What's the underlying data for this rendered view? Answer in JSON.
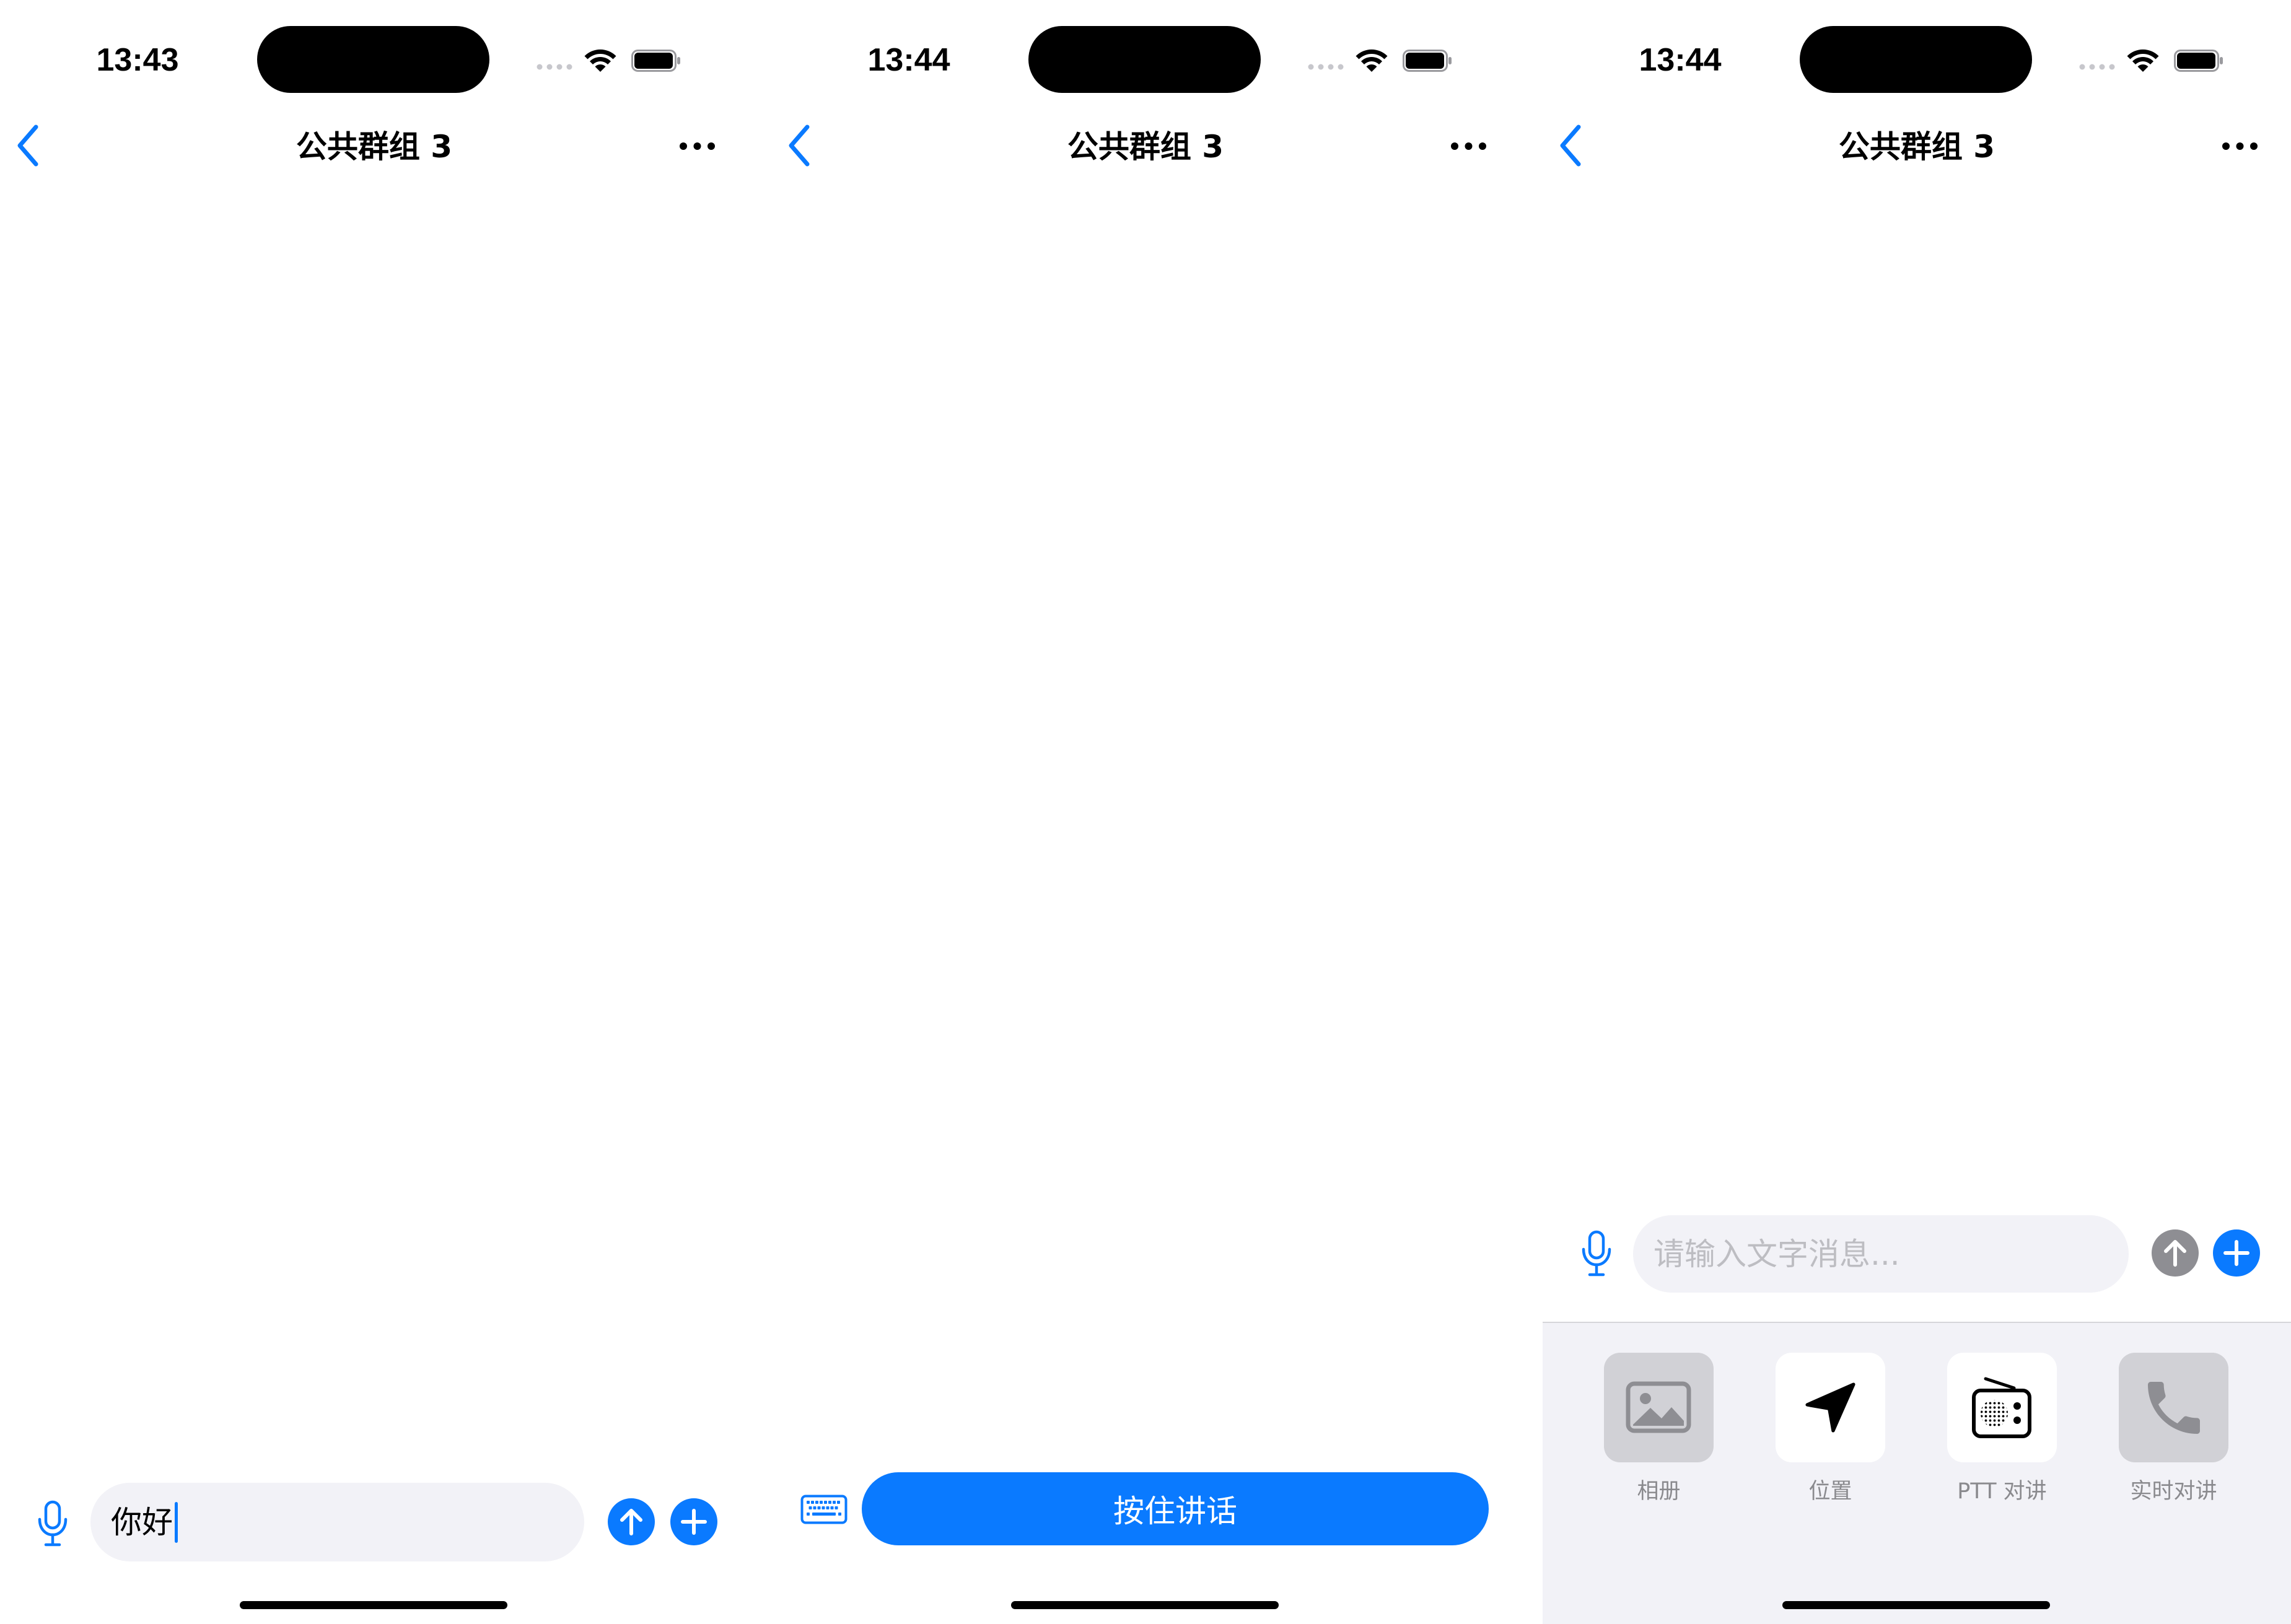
{
  "colors": {
    "accent": "#0A7AFF",
    "text": "#000000",
    "secondary_text": "#8A8A8E",
    "placeholder": "#BDBDC2",
    "field_background": "#F2F2F7",
    "panel_background": "#F2F2F7",
    "icon_muted": "#8E8E93"
  },
  "screens": [
    {
      "status_bar": {
        "time": "13:43",
        "signal_icon": "cellular-signal-icon",
        "wifi_icon": "wifi-icon",
        "battery_icon": "battery-icon",
        "battery_level": 1.0
      },
      "nav": {
        "back_icon": "chevron-left-icon",
        "title": "公共群组 3",
        "more_icon": "ellipsis-icon"
      },
      "composer": {
        "voice_icon": "microphone-icon",
        "value": "你好",
        "send_icon": "arrow-up-circle-icon",
        "add_icon": "plus-circle-icon"
      }
    },
    {
      "status_bar": {
        "time": "13:44",
        "signal_icon": "cellular-signal-icon",
        "wifi_icon": "wifi-icon",
        "battery_icon": "battery-icon",
        "battery_level": 1.0
      },
      "nav": {
        "back_icon": "chevron-left-icon",
        "title": "公共群组 3",
        "more_icon": "ellipsis-icon"
      },
      "composer": {
        "keyboard_icon": "keyboard-icon",
        "hold_to_talk_label": "按住讲话"
      }
    },
    {
      "status_bar": {
        "time": "13:44",
        "signal_icon": "cellular-signal-icon",
        "wifi_icon": "wifi-icon",
        "battery_icon": "battery-icon",
        "battery_level": 1.0
      },
      "nav": {
        "back_icon": "chevron-left-icon",
        "title": "公共群组 3",
        "more_icon": "ellipsis-icon"
      },
      "composer": {
        "voice_icon": "microphone-icon",
        "placeholder": "请输入文字消息...",
        "send_icon": "arrow-up-circle-icon",
        "send_button_color": "#8E8E93",
        "add_icon": "plus-circle-icon"
      },
      "extras_panel": {
        "items": [
          {
            "label": "相册",
            "icon": "photo-icon",
            "tile_color": "#D1D1D6"
          },
          {
            "label": "位置",
            "icon": "location-arrow-icon",
            "tile_color": "#FFFFFF"
          },
          {
            "label": "PTT 对讲",
            "icon": "radio-icon",
            "tile_color": "#FFFFFF"
          },
          {
            "label": "实时对讲",
            "icon": "phone-icon",
            "tile_color": "#D1D1D6"
          }
        ]
      }
    }
  ]
}
